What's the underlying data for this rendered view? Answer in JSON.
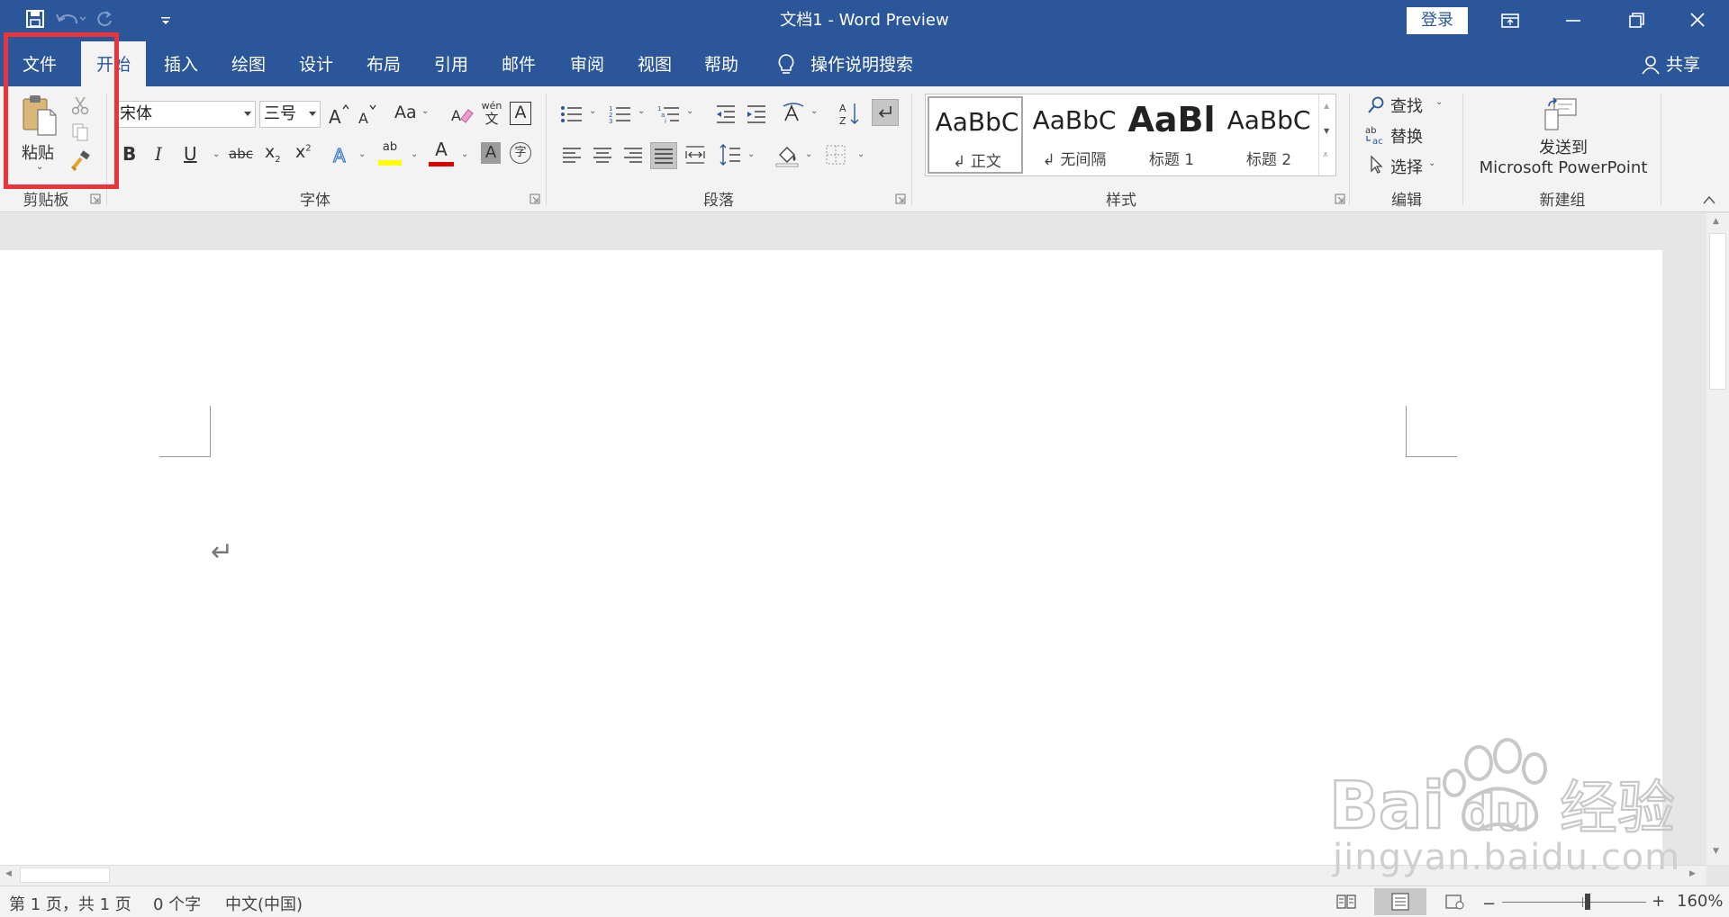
{
  "app": {
    "title": "文档1  -  Word Preview",
    "login": "登录"
  },
  "tabs": [
    "文件",
    "开始",
    "插入",
    "绘图",
    "设计",
    "布局",
    "引用",
    "邮件",
    "审阅",
    "视图",
    "帮助"
  ],
  "tell_me": "操作说明搜索",
  "share": "共享",
  "ribbon": {
    "clipboard": {
      "paste": "粘贴",
      "label": "剪贴板"
    },
    "font": {
      "name": "宋体",
      "size": "三号",
      "label": "字体",
      "case_btn": "Aa",
      "phonetic_top": "wén",
      "phonetic_bottom": "文",
      "border_char": "A",
      "bold": "B",
      "italic": "I",
      "underline": "U",
      "strike": "abc",
      "sub": "x",
      "sup": "x",
      "highlight_ab": "ab",
      "color_a": "A",
      "shade_a": "A",
      "enclose": "字"
    },
    "paragraph": {
      "label": "段落"
    },
    "styles": {
      "label": "样式",
      "items": [
        {
          "preview": "AaBbC",
          "name": "↲ 正文"
        },
        {
          "preview": "AaBbC",
          "name": "↲ 无间隔"
        },
        {
          "preview": "AaBl",
          "name": "标题 1"
        },
        {
          "preview": "AaBbC",
          "name": "标题 2"
        }
      ]
    },
    "editing": {
      "find": "查找",
      "replace": "替换",
      "select": "选择",
      "label": "编辑"
    },
    "send": {
      "line1": "发送到",
      "line2": "Microsoft PowerPoint",
      "label": "新建组"
    }
  },
  "document": {
    "paragraph_mark": "↵"
  },
  "status": {
    "page": "第 1 页，共 1 页",
    "words": "0 个字",
    "lang": "中文(中国)",
    "zoom": "160%"
  },
  "watermark": {
    "brand": "Bai du 经验",
    "url": "jingyan.baidu.com"
  },
  "colors": {
    "title_bar": "#2b579a",
    "ribbon": "#f3f3f3",
    "highlight": "#e8343b",
    "font_color": "#e00000",
    "highlight_color": "#ffff00"
  }
}
